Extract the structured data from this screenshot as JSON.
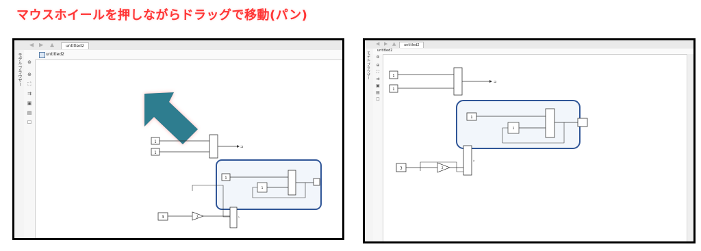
{
  "heading": "マウスホイールを押しながらドラッグで移動(パン)",
  "accent_color": "#ff3434",
  "highlight_color": "#2f5597",
  "arrow_color": "#2e7d8f",
  "left_screenshot": {
    "tab_label": "untitled2",
    "address_label": "untitled2",
    "side_panel_label": "モデル ブラウザー",
    "palette_icons": [
      "hide-browser-icon",
      "zoom-icon",
      "fit-view-icon",
      "arrow-routing-icon",
      "image-icon",
      "annotation-icon",
      "checkbox-icon"
    ],
    "blocks": {
      "const_a": "1",
      "const_b": "1",
      "const_c": "1",
      "const_d": "3",
      "subsystem_label": "1",
      "gain_label": "2"
    }
  },
  "right_screenshot": {
    "tab_label": "untitled2",
    "address_label": "untitled2",
    "side_panel_label": "モデル ブラウザー",
    "palette_icons": [
      "hide-browser-icon",
      "zoom-icon",
      "fit-view-icon",
      "arrow-routing-icon",
      "image-icon",
      "annotation-icon",
      "checkbox-icon"
    ],
    "blocks": {
      "const_a": "1",
      "const_b": "1",
      "const_c": "1",
      "const_d": "3",
      "subsystem_label": "1",
      "gain_label": "2"
    }
  }
}
